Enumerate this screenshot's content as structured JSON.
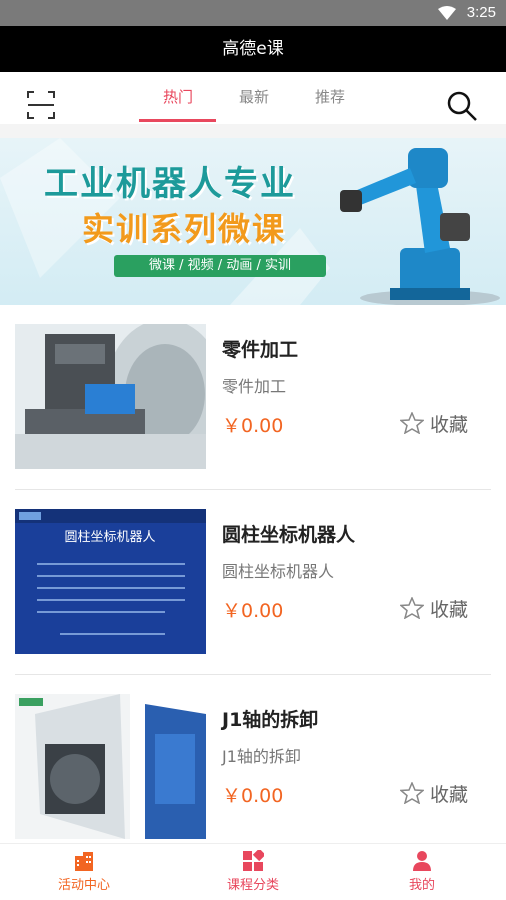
{
  "statusbar": {
    "time": "3:25"
  },
  "app": {
    "title": "高德e课"
  },
  "tabs": [
    {
      "label": "热门",
      "active": true
    },
    {
      "label": "最新",
      "active": false
    },
    {
      "label": "推荐",
      "active": false
    }
  ],
  "banner": {
    "line1": "工业机器人专业",
    "line2": "实训系列微课",
    "tagline": "微课 / 视频 / 动画 / 实训"
  },
  "courses": [
    {
      "name": "零件加工",
      "subtitle": "零件加工",
      "price": "￥0.00",
      "fav_label": "收藏"
    },
    {
      "name": "圆柱坐标机器人",
      "subtitle": "圆柱坐标机器人",
      "price": "￥0.00",
      "fav_label": "收藏"
    },
    {
      "name": "J1轴的拆卸",
      "subtitle": "J1轴的拆卸",
      "price": "￥0.00",
      "fav_label": "收藏"
    }
  ],
  "thumb2": {
    "heading": "圆柱坐标机器人"
  },
  "bottom_nav": [
    {
      "label": "活动中心",
      "color": "#f26522"
    },
    {
      "label": "课程分类",
      "color": "#e8475d"
    },
    {
      "label": "我的",
      "color": "#e8475d"
    }
  ],
  "colors": {
    "accent": "#e8475d",
    "price": "#f26522",
    "titlebar": "#000000"
  }
}
